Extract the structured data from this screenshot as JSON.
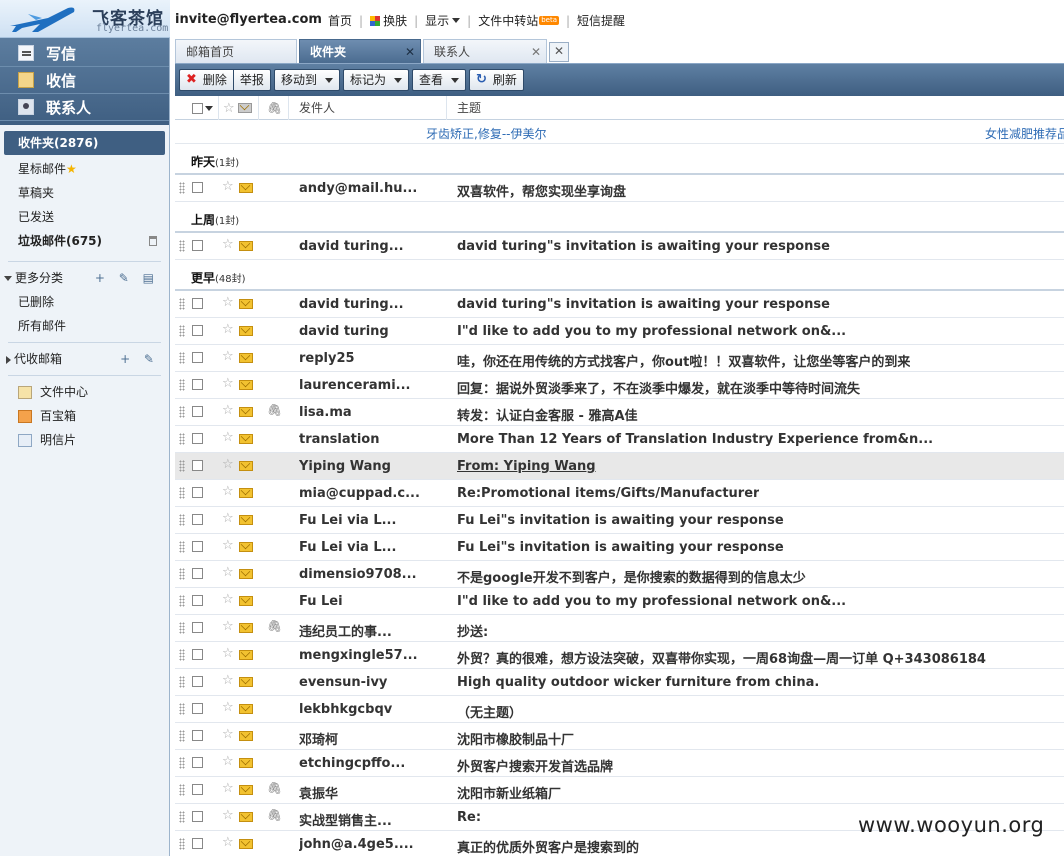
{
  "header": {
    "logo_text": "飞客茶馆",
    "logo_domain": "flyertea.com",
    "user_email": "invite@flyertea.com",
    "nav": [
      {
        "label": "首页"
      },
      {
        "label": "换肤",
        "icon": "skin-icon"
      },
      {
        "label": "显示",
        "caret": true
      },
      {
        "label": "文件中转站",
        "badge": "beta"
      },
      {
        "label": "短信提醒"
      }
    ]
  },
  "sidebar": {
    "actions": [
      {
        "label": "写信",
        "icon": "compose-icon"
      },
      {
        "label": "收信",
        "icon": "inbox-icon"
      },
      {
        "label": "联系人",
        "icon": "contacts-icon"
      }
    ],
    "folders": [
      {
        "label": "收件夹(2876)",
        "active": true
      },
      {
        "label": "星标邮件",
        "star": "★"
      },
      {
        "label": "草稿夹"
      },
      {
        "label": "已发送"
      },
      {
        "label": "垃圾邮件(675)",
        "bold": true,
        "trash": true
      }
    ],
    "more": {
      "label": "更多分类",
      "tools": "+ ✎ ▤",
      "items": [
        {
          "label": "已删除"
        },
        {
          "label": "所有邮件"
        }
      ]
    },
    "proxy": {
      "label": "代收邮箱",
      "tools": "+ ✎"
    },
    "tools": [
      {
        "label": "文件中心",
        "icon": "folder-icon"
      },
      {
        "label": "百宝箱",
        "icon": "treasure-box-icon"
      },
      {
        "label": "明信片",
        "icon": "postcard-icon"
      }
    ]
  },
  "tabs": [
    {
      "label": "邮箱首页",
      "close": ""
    },
    {
      "label": "收件夹",
      "close": "✕",
      "active": true
    },
    {
      "label": "联系人",
      "close": "✕"
    }
  ],
  "tab_new": "✕",
  "toolbar": {
    "delete": "删除",
    "report": "举报",
    "move_to": "移动到",
    "mark_as": "标记为",
    "view": "查看",
    "refresh": "刷新"
  },
  "columns": {
    "from": "发件人",
    "subject": "主题"
  },
  "ads": {
    "left": "牙齿矫正,修复--伊美尔",
    "right": "女性减肥推荐品"
  },
  "groups": [
    {
      "title": "昨天",
      "count": "(1封)",
      "rows": [
        {
          "from": "andy@mail.hu...",
          "subject": "双喜软件，帮您实现坐享询盘",
          "clip": false
        }
      ]
    },
    {
      "title": "上周",
      "count": "(1封)",
      "rows": [
        {
          "from": "david turing...",
          "subject": "david turing\"s invitation is awaiting your response",
          "clip": false
        }
      ]
    },
    {
      "title": "更早",
      "count": "(48封)",
      "rows": [
        {
          "from": "david turing...",
          "subject": "david turing\"s invitation is awaiting your response",
          "clip": false
        },
        {
          "from": "david turing",
          "subject": "I\"d like to add you to my professional network on&...",
          "clip": false
        },
        {
          "from": "reply25",
          "subject": "哇，你还在用传统的方式找客户，你out啦！！双喜软件，让您坐等客户的到来",
          "clip": false
        },
        {
          "from": "laurencerami...",
          "subject": "回复：据说外贸淡季来了，不在淡季中爆发，就在淡季中等待时间流失",
          "clip": false
        },
        {
          "from": "lisa.ma",
          "subject": "转发：认证白金客服 - 雅高A佳",
          "clip": true
        },
        {
          "from": "translation",
          "subject": "More Than 12 Years of Translation Industry Experience from&n...",
          "clip": false
        },
        {
          "from": "Yiping Wang",
          "subject": "From: Yiping Wang",
          "clip": false,
          "hl": true
        },
        {
          "from": "mia@cuppad.c...",
          "subject": "Re:Promotional items/Gifts/Manufacturer",
          "clip": false
        },
        {
          "from": "Fu Lei via L...",
          "subject": "Fu Lei\"s invitation is awaiting your response",
          "clip": false
        },
        {
          "from": "Fu Lei via L...",
          "subject": "Fu Lei\"s invitation is awaiting your response",
          "clip": false
        },
        {
          "from": "dimensio9708...",
          "subject": "不是google开发不到客户，是你搜索的数据得到的信息太少",
          "clip": false
        },
        {
          "from": "Fu Lei",
          "subject": "I\"d like to add you to my professional network on&...",
          "clip": false
        },
        {
          "from": "违纪员工的事...",
          "subject": "抄送:",
          "clip": true
        },
        {
          "from": "mengxingle57...",
          "subject": "外贸？真的很难，想方设法突破，双喜带你实现，一周68询盘—周一订单 Q+343086184",
          "clip": false
        },
        {
          "from": "evensun-ivy",
          "subject": "High quality outdoor wicker furniture from china.",
          "clip": false
        },
        {
          "from": "lekbhkgcbqv",
          "subject": "（无主题）",
          "clip": false
        },
        {
          "from": "邓琦柯",
          "subject": "沈阳市橡胶制品十厂",
          "clip": false
        },
        {
          "from": "etchingcpffo...",
          "subject": "外贸客户搜索开发首选品牌",
          "clip": false
        },
        {
          "from": "袁振华",
          "subject": "沈阳市新业纸箱厂",
          "clip": true
        },
        {
          "from": "实战型销售主...",
          "subject": "Re:",
          "clip": true
        },
        {
          "from": "john@a.4ge5....",
          "subject": "真正的优质外贸客户是搜索到的",
          "clip": false
        }
      ]
    }
  ],
  "watermark": "www.wooyun.org"
}
